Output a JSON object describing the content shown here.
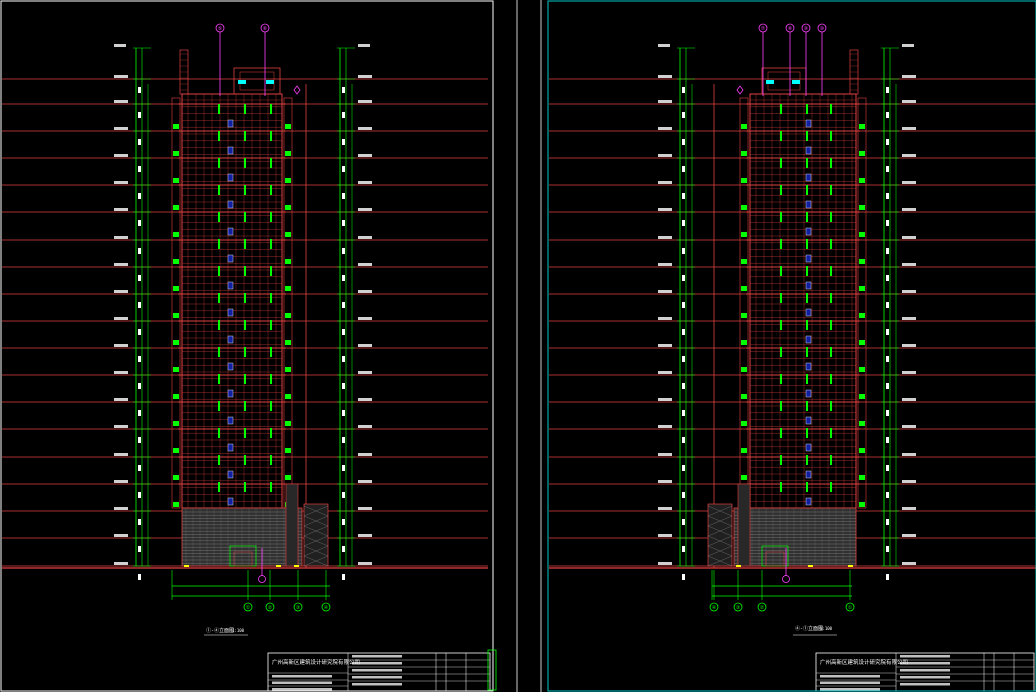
{
  "colors": {
    "background": "#000000",
    "frame": "#ffffff",
    "accent_frame": "#00c8c8",
    "facade": "#e04040",
    "dim": "#00ff00",
    "axis": "#ff40ff",
    "text": "#ffffff",
    "yellow": "#ffff00",
    "cyan": "#00ffff",
    "base": "#909090"
  },
  "sheets": [
    {
      "elevation_title": "①-④立面图",
      "scale": "1:100",
      "company": "广州高新区建筑设计研究院有限公司",
      "axis_bottom": [
        "①",
        "②",
        "③",
        "④"
      ],
      "axis_top": [
        "⑤",
        "⑥"
      ]
    },
    {
      "elevation_title": "④-①立面图",
      "scale": "1:100",
      "company": "广州高新区建筑设计研究院有限公司",
      "axis_bottom": [
        "④",
        "③",
        "②",
        "①"
      ],
      "axis_top": [
        "⑦",
        "⑧",
        "⑨",
        "⑩"
      ]
    }
  ]
}
